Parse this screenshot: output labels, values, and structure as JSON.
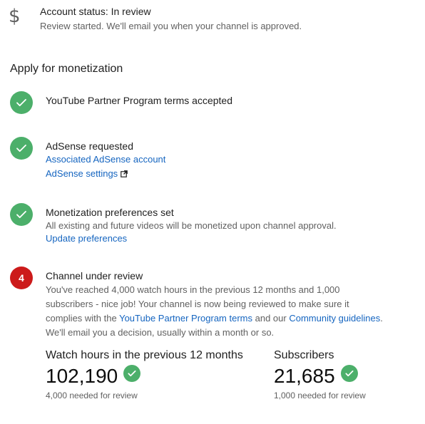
{
  "status": {
    "icon": "dollar-icon",
    "title": "Account status: In review",
    "subtitle": "Review started. We'll email you when your channel is approved."
  },
  "section_title": "Apply for monetization",
  "steps": [
    {
      "title": "YouTube Partner Program terms accepted",
      "state": "complete"
    },
    {
      "title": "AdSense requested",
      "state": "complete",
      "link_account": "Associated AdSense account",
      "link_settings": "AdSense settings"
    },
    {
      "title": "Monetization preferences set",
      "state": "complete",
      "description": "All existing and future videos will be monetized upon channel approval.",
      "link_update": "Update preferences"
    },
    {
      "number": "4",
      "title": "Channel under review",
      "state": "in-review",
      "desc_line1": "You've reached 4,000 watch hours in the previous 12 months and 1,000",
      "desc_line2": "subscribers - nice job! Your channel is now being reviewed to make sure it",
      "desc_line3_a": "complies with the ",
      "desc_line3_link1": "YouTube Partner Program terms",
      "desc_line3_b": " and our ",
      "desc_line3_link2": "Community guidelines",
      "desc_line3_c": ".",
      "desc_line4": "We'll email you a decision, usually within a month or so."
    }
  ],
  "metrics": [
    {
      "label": "Watch hours in the previous 12 months",
      "value": "102,190",
      "note": "4,000 needed for review"
    },
    {
      "label": "Subscribers",
      "value": "21,685",
      "note": "1,000 needed for review"
    }
  ],
  "colors": {
    "success": "#4caf6a",
    "alert": "#cc1a1a",
    "link": "#1565c0"
  }
}
